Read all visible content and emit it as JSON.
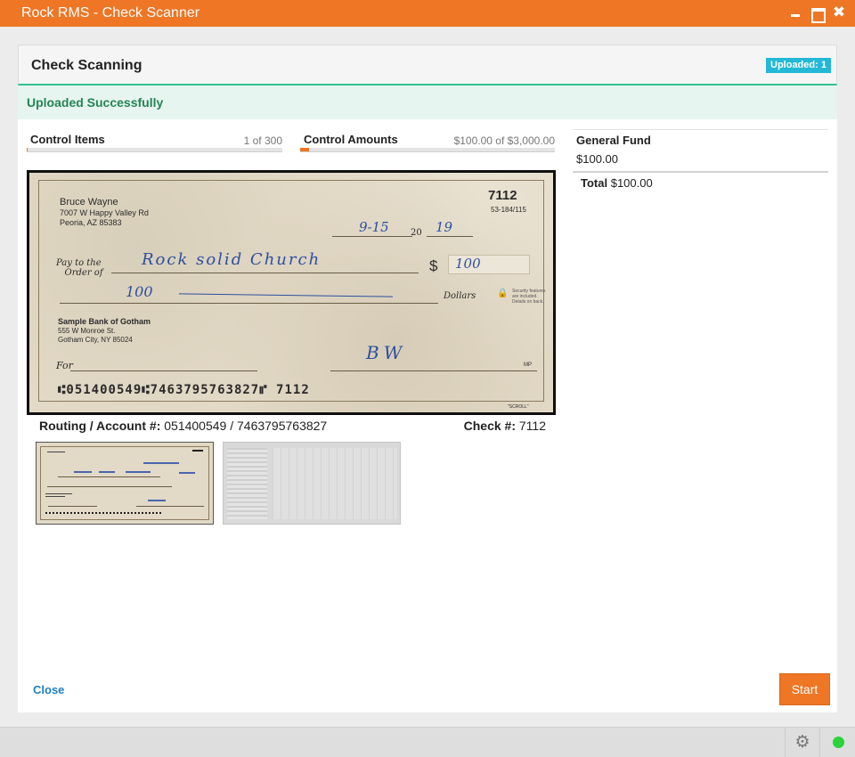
{
  "window": {
    "title": "Rock RMS - Check Scanner",
    "close_glyph": "✖"
  },
  "header": {
    "title": "Check Scanning",
    "badge": "Uploaded: 1"
  },
  "alert": {
    "message": "Uploaded Successfully"
  },
  "controls": {
    "items": {
      "label": "Control Items",
      "value": "1 of 300",
      "progress_fraction": 0.0033
    },
    "amounts": {
      "label": "Control Amounts",
      "value": "$100.00 of $3,000.00",
      "progress_fraction": 0.0333
    }
  },
  "check": {
    "name": "Bruce Wayne",
    "address1": "7007 W Happy Valley Rd",
    "address2": "Peoria, AZ 85383",
    "number": "7112",
    "fraction": "53-184/115",
    "date": "9-15",
    "year_prefix": "20",
    "year": "19",
    "pay_to_1": "Pay to the",
    "pay_to_2": "Order of",
    "payee": "Rock solid Church",
    "dollar_sign": "$",
    "amount": "100",
    "written_amount": "100",
    "dollars_label": "Dollars",
    "lock_glyph": "🔒",
    "security_note": "Security features are included. Details on back.",
    "bank_name": "Sample Bank of Gotham",
    "bank_address1": "555 W Monroe St.",
    "bank_address2": "Gotham City, NY 85024",
    "for_label": "For",
    "signature": "BW",
    "mp_label": "MP",
    "micr": "⑆051400549⑆7463795763827⑈ 7112",
    "brand": "\"SCROLL\""
  },
  "info": {
    "routing_label": "Routing / Account #:",
    "routing_value": "051400549 / 7463795763827",
    "check_label": "Check #:",
    "check_value": "7112"
  },
  "thumbnails": [
    {
      "name": "check-front-thumbnail"
    },
    {
      "name": "check-back-thumbnail"
    }
  ],
  "fund": {
    "name": "General Fund",
    "amount": "$100.00",
    "total_label": "Total",
    "total_value": "$100.00"
  },
  "footer": {
    "close_label": "Close",
    "start_label": "Start"
  },
  "statusbar": {
    "gear_glyph": "⚙",
    "status_color": "#2ad33a"
  },
  "colors": {
    "accent": "#ee7625",
    "success": "#248454",
    "info": "#22b8d6",
    "link": "#1e7fc4"
  }
}
